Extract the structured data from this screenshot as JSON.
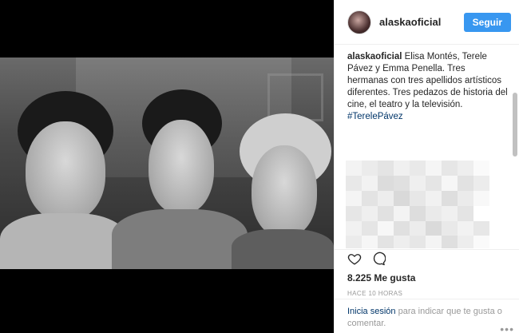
{
  "post": {
    "username": "alaskaoficial",
    "follow_label": "Seguir",
    "caption_user": "alaskaoficial",
    "caption_text": "Elisa Montés, Terele Pávez y Emma Penella. Tres hermanas con tres apellidos artísticos diferentes. Tres pedazos de historia del cine, el teatro y la televisión.",
    "hashtag": "#TerelePávez",
    "likes": "8.225 Me gusta",
    "time": "HACE 10 HORAS"
  },
  "footer": {
    "login_link": "Inicia sesión",
    "login_text": "para indicar que te gusta o comentar.",
    "more": "•••"
  },
  "icons": {
    "like": "heart-icon",
    "comment": "comment-icon",
    "options": "more-options-icon"
  },
  "colors": {
    "follow_button": "#3897f0",
    "link": "#003569",
    "muted": "#999999"
  }
}
